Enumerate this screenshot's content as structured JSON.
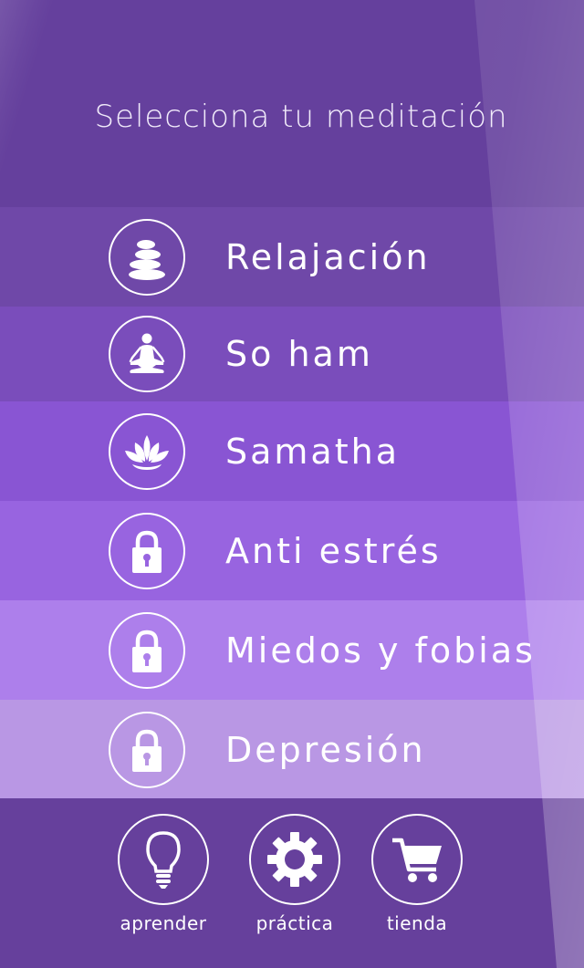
{
  "header": {
    "title": "Selecciona tu meditación"
  },
  "meditations": [
    {
      "label": "Relajación",
      "icon": "stones-icon",
      "locked": false,
      "bg": "#6f48a8"
    },
    {
      "label": "So ham",
      "icon": "meditation-pose-icon",
      "locked": false,
      "bg": "#7a4dbb"
    },
    {
      "label": "Samatha",
      "icon": "lotus-icon",
      "locked": false,
      "bg": "#8955d3"
    },
    {
      "label": "Anti estrés",
      "icon": "lock-icon",
      "locked": true,
      "bg": "#9864e0"
    },
    {
      "label": "Miedos y fobias",
      "icon": "lock-icon",
      "locked": true,
      "bg": "#ad7feb"
    },
    {
      "label": "Depresión",
      "icon": "lock-icon",
      "locked": true,
      "bg": "#b997e4"
    }
  ],
  "bottom_nav": [
    {
      "label": "aprender",
      "icon": "lightbulb-icon"
    },
    {
      "label": "práctica",
      "icon": "gear-icon"
    },
    {
      "label": "tienda",
      "icon": "cart-icon"
    }
  ]
}
